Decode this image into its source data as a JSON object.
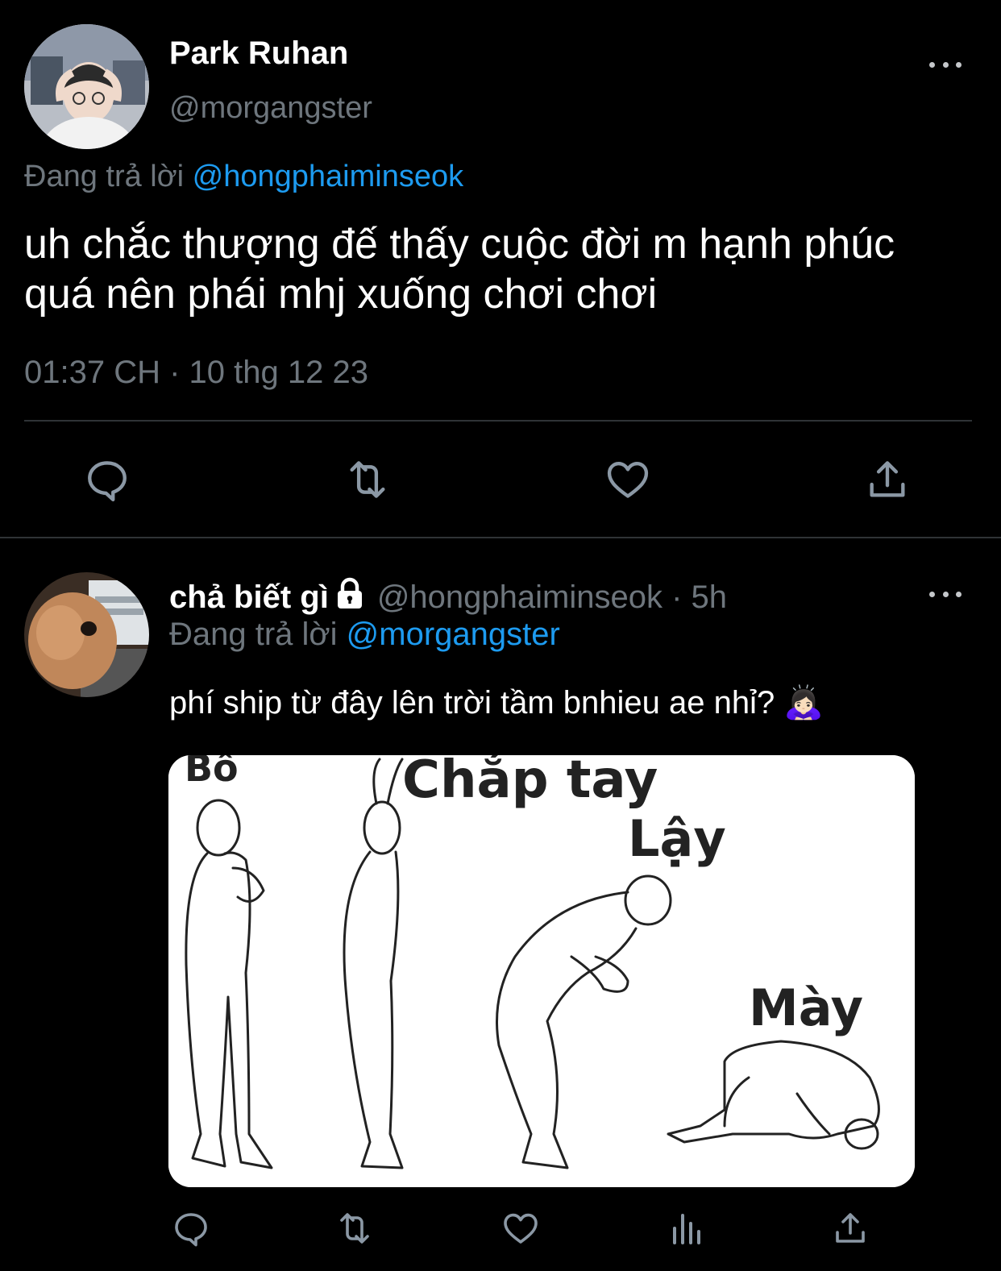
{
  "main_tweet": {
    "display_name": "Park Ruhan",
    "handle": "@morgangster",
    "replying_prefix": "Đang trả lời",
    "replying_to": "@hongphaiminseok",
    "text_line1": "uh chắc thượng đế thấy cuộc đời m hạnh phúc",
    "text_line2": "quá nên phái mhj xuống chơi chơi",
    "timestamp": "01:37 CH · 10 thg 12 23",
    "avatar_icon": "profile-photo-person",
    "actions": [
      "reply-icon",
      "retweet-icon",
      "like-icon",
      "share-icon"
    ]
  },
  "reply_tweet": {
    "display_name": "chả biết gì",
    "lock_icon": "lock-icon",
    "handle_time": "@hongphaiminseok · 5h",
    "replying_prefix": "Đang trả lời",
    "replying_to": "@morgangster",
    "text": "phí ship từ đây lên trời tầm bnhieu ae nhỉ?",
    "emoji": "🙇🏻‍♀️",
    "avatar_icon": "profile-photo-cat-laptop",
    "meme": {
      "label1": "Bố",
      "label2": "Chắp tay",
      "label3": "Lậy",
      "label4": "Mày"
    },
    "actions": [
      "reply-icon",
      "retweet-icon",
      "like-icon",
      "views-icon",
      "share-icon"
    ]
  },
  "colors": {
    "background": "#000000",
    "link": "#1d9bf0",
    "muted": "#6e767d",
    "icon": "#8b98a5"
  }
}
